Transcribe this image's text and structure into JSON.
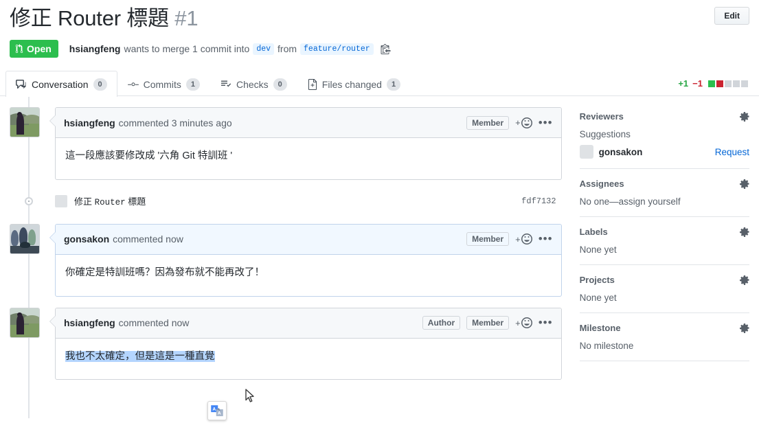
{
  "header": {
    "title": "修正 Router 標題",
    "number": "#1",
    "edit_label": "Edit",
    "state": "Open",
    "state_color": "#2cbe4e",
    "author": "hsiangfeng",
    "merge_text_1": "wants to merge 1 commit into",
    "base_branch": "dev",
    "merge_text_2": "from",
    "head_branch": "feature/router",
    "copy_icon": "copy-branch-icon"
  },
  "tabs": [
    {
      "label": "Conversation",
      "count": "0",
      "icon": "comment-discussion-icon",
      "active": true
    },
    {
      "label": "Commits",
      "count": "1",
      "icon": "git-commit-icon",
      "active": false
    },
    {
      "label": "Checks",
      "count": "0",
      "icon": "checklist-icon",
      "active": false
    },
    {
      "label": "Files changed",
      "count": "1",
      "icon": "file-diff-icon",
      "active": false
    }
  ],
  "diffstat": {
    "additions": "+1",
    "deletions": "−1",
    "add_color": "#28a745",
    "del_color": "#cb2431",
    "blocks": [
      "g",
      "r",
      "n",
      "n",
      "n"
    ]
  },
  "timeline": [
    {
      "type": "comment",
      "author": "hsiangfeng",
      "when": "commented 3 minutes ago",
      "badges": [
        "Member"
      ],
      "body": "這一段應該要修改成 '六角 Git 特訓班 '",
      "self": false,
      "avatar": "field",
      "selected": false
    },
    {
      "type": "commit",
      "message_plain": "修正 ",
      "message_mono": "Router",
      "message_tail": " 標題",
      "sha": "fdf7132",
      "avatar": "field"
    },
    {
      "type": "comment",
      "author": "gonsakon",
      "when": "commented now",
      "badges": [
        "Member"
      ],
      "body": "你確定是特訓班嗎？因為發布就不能再改了！",
      "self": true,
      "avatar": "group",
      "selected": false
    },
    {
      "type": "comment",
      "author": "hsiangfeng",
      "when": "commented now",
      "badges": [
        "Author",
        "Member"
      ],
      "body": "我也不太確定，但是這是一種直覺",
      "self": false,
      "avatar": "field",
      "selected": true
    }
  ],
  "sidebar": [
    {
      "title": "Reviewers",
      "subtitle": "Suggestions",
      "reviewer": {
        "name": "gonsakon",
        "action": "Request",
        "avatar": "group"
      },
      "text": null
    },
    {
      "title": "Assignees",
      "subtitle": null,
      "reviewer": null,
      "text": "No one—assign yourself"
    },
    {
      "title": "Labels",
      "subtitle": null,
      "reviewer": null,
      "text": "None yet"
    },
    {
      "title": "Projects",
      "subtitle": null,
      "reviewer": null,
      "text": "None yet"
    },
    {
      "title": "Milestone",
      "subtitle": null,
      "reviewer": null,
      "text": "No milestone"
    }
  ],
  "overlay": {
    "translate_icon": "google-translate-icon",
    "cursor": "mouse-pointer-icon"
  }
}
